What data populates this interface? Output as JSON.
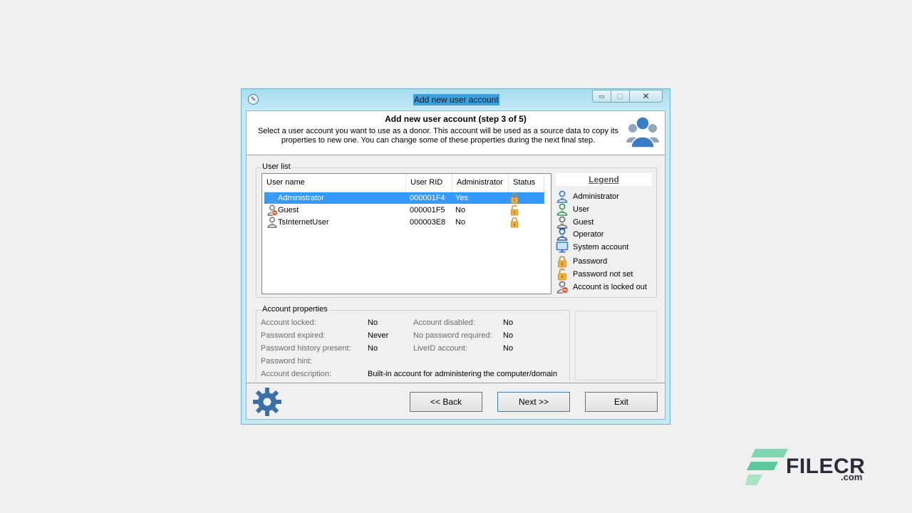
{
  "window": {
    "title": "Add new user account",
    "min_symbol": "▭",
    "max_symbol": "▢",
    "close_symbol": "✕"
  },
  "header": {
    "title": "Add new user account (step 3 of 5)",
    "description": "Select a user account you want to use as a donor. This account will be used as a source data to copy its properties to new one. You can change some of these properties during the next final step."
  },
  "user_list": {
    "group_label": "User list",
    "columns": [
      "User name",
      "User RID",
      "Administrator",
      "Status"
    ],
    "rows": [
      {
        "icon": "administrator-icon",
        "name": "Administrator",
        "rid": "000001F4",
        "admin": "Yes",
        "status_icon": "password-icon",
        "selected": true
      },
      {
        "icon": "guest-locked-icon",
        "name": "Guest",
        "rid": "000001F5",
        "admin": "No",
        "status_icon": "password-not-set-icon",
        "selected": false
      },
      {
        "icon": "guest-icon",
        "name": "TsInternetUser",
        "rid": "000003E8",
        "admin": "No",
        "status_icon": "password-icon",
        "selected": false
      }
    ]
  },
  "legend": {
    "title": "Legend",
    "items": [
      {
        "icon": "administrator-icon",
        "label": "Administrator"
      },
      {
        "icon": "user-icon",
        "label": "User"
      },
      {
        "icon": "guest-icon",
        "label": "Guest"
      },
      {
        "icon": "operator-icon",
        "label": "Operator"
      },
      {
        "icon": "system-account-icon",
        "label": "System account"
      },
      {
        "icon": "password-icon",
        "label": "Password"
      },
      {
        "icon": "password-not-set-icon",
        "label": "Password not set"
      },
      {
        "icon": "account-locked-out-icon",
        "label": "Account is locked out"
      }
    ]
  },
  "account_properties": {
    "group_label": "Account properties",
    "account_locked_label": "Account locked:",
    "account_locked_value": "No",
    "password_expired_label": "Password expired:",
    "password_expired_value": "Never",
    "password_history_label": "Password history present:",
    "password_history_value": "No",
    "password_hint_label": "Password hint:",
    "password_hint_value": "",
    "account_description_label": "Account description:",
    "account_description_value": "Built-in account for administering the computer/domain",
    "account_disabled_label": "Account disabled:",
    "account_disabled_value": "No",
    "no_password_required_label": "No password required:",
    "no_password_required_value": "No",
    "liveid_label": "LiveID account:",
    "liveid_value": "No"
  },
  "buttons": {
    "back": "<< Back",
    "next": "Next >>",
    "exit": "Exit"
  },
  "watermark": {
    "text": "FILECR",
    "suffix": ".com"
  },
  "colors": {
    "selection": "#3399ff",
    "lock": "#f0a830",
    "user_blue": "#3b7cc4",
    "user_green": "#3a9a5a",
    "guest_gray": "#707070"
  }
}
